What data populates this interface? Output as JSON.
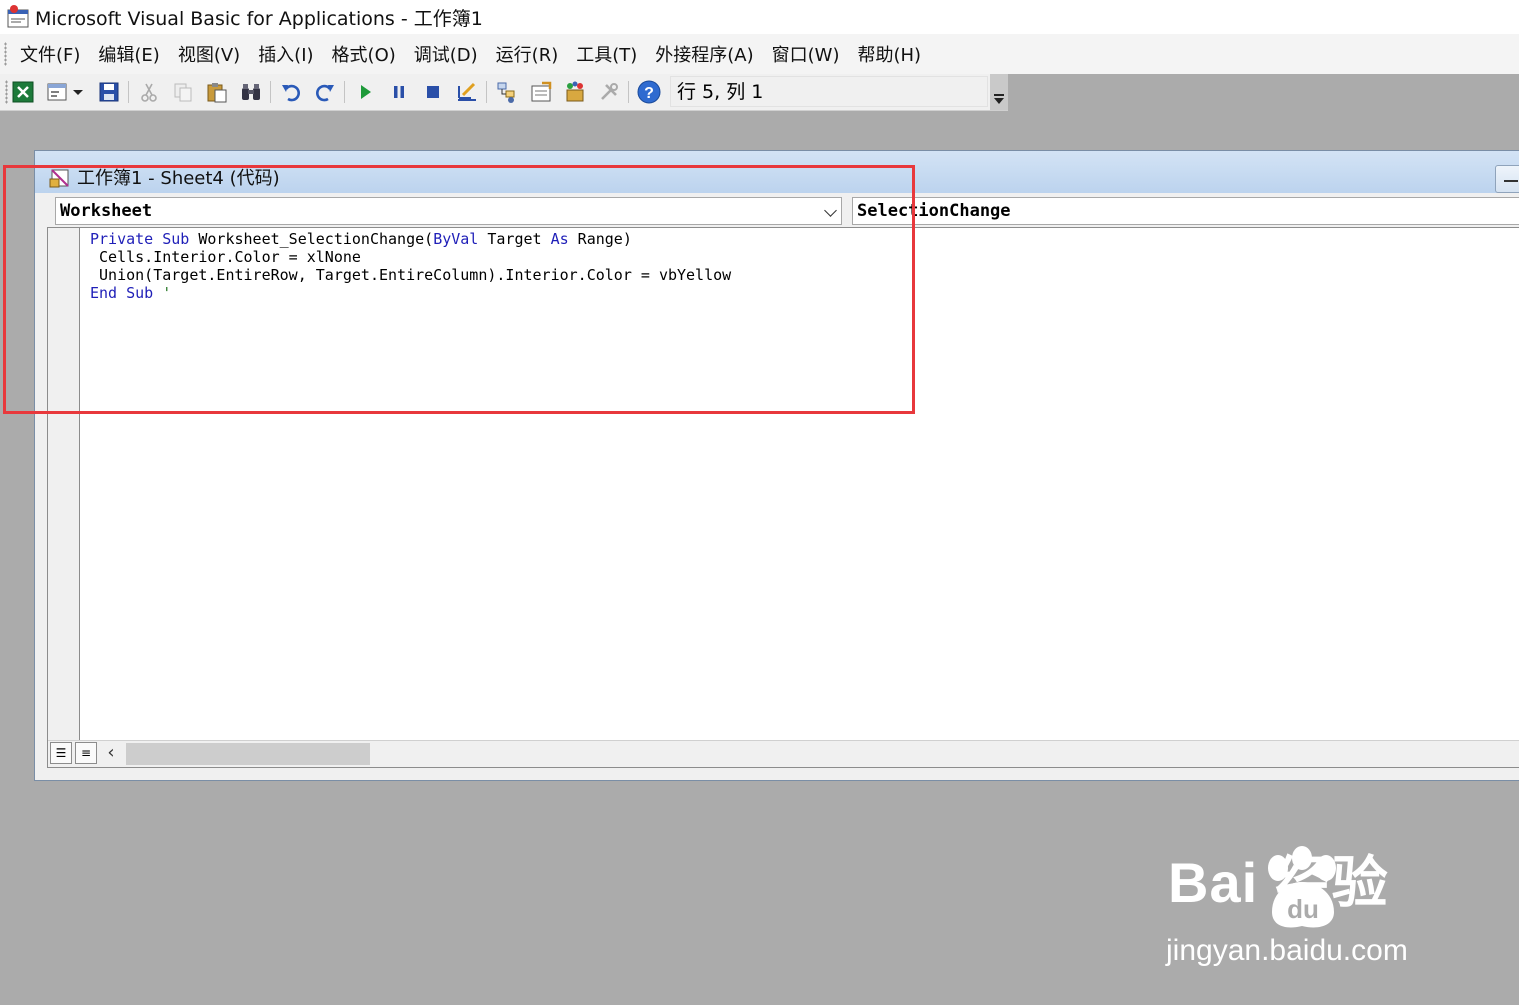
{
  "window": {
    "title": "Microsoft Visual Basic for Applications - 工作簿1"
  },
  "menubar": {
    "items": [
      {
        "label": "文件(F)"
      },
      {
        "label": "编辑(E)"
      },
      {
        "label": "视图(V)"
      },
      {
        "label": "插入(I)"
      },
      {
        "label": "格式(O)"
      },
      {
        "label": "调试(D)"
      },
      {
        "label": "运行(R)"
      },
      {
        "label": "工具(T)"
      },
      {
        "label": "外接程序(A)"
      },
      {
        "label": "窗口(W)"
      },
      {
        "label": "帮助(H)"
      }
    ]
  },
  "toolbar": {
    "cursor_position": "行 5, 列 1",
    "icons": [
      "excel-view-icon",
      "insert-userform-icon",
      "save-icon",
      "cut-icon",
      "copy-icon",
      "paste-icon",
      "find-icon",
      "undo-icon",
      "redo-icon",
      "run-icon",
      "break-icon",
      "reset-icon",
      "design-mode-icon",
      "project-explorer-icon",
      "properties-window-icon",
      "object-browser-icon",
      "toolbox-icon",
      "help-icon"
    ]
  },
  "code_window": {
    "title": "工作簿1 - Sheet4 (代码)",
    "object_dropdown": "Worksheet",
    "procedure_dropdown": "SelectionChange",
    "code": {
      "line1_kw1": "Private Sub",
      "line1_text1": " Worksheet_SelectionChange(",
      "line1_kw2": "ByVal",
      "line1_text2": " Target ",
      "line1_kw3": "As",
      "line1_text3": " Range)",
      "line2": " Cells.Interior.Color = xlNone",
      "line3": " Union(Target.EntireRow, Target.EntireColumn).Interior.Color = vbYellow",
      "line4_kw": "End Sub",
      "line4_comment": " '"
    }
  },
  "colors": {
    "highlight_box": "#e8383c",
    "keyword": "#1f1fb8",
    "mdi_background": "#ababab"
  },
  "watermark": {
    "brand": "Bai  经验",
    "url": "jingyan.baidu.com"
  }
}
